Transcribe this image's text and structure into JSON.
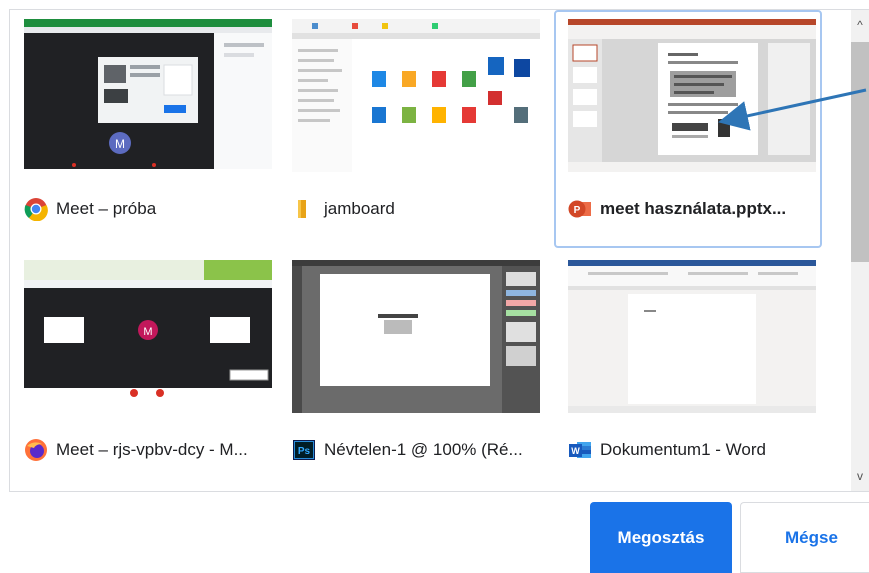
{
  "picker": {
    "tiles": [
      {
        "label": "Meet – próba",
        "icon": "chrome-icon",
        "selected": false
      },
      {
        "label": "jamboard",
        "icon": "folder-icon",
        "selected": false
      },
      {
        "label": "meet használata.pptx...",
        "icon": "powerpoint-icon",
        "icon_text": "P",
        "selected": true
      },
      {
        "label": "Meet – rjs-vpbv-dcy - M...",
        "icon": "firefox-icon",
        "selected": false
      },
      {
        "label": "Névtelen-1 @ 100% (Ré...",
        "icon": "photoshop-icon",
        "icon_text": "Ps",
        "selected": false
      },
      {
        "label": "Dokumentum1 - Word",
        "icon": "word-icon",
        "icon_text": "W",
        "selected": false
      }
    ],
    "thumbs": {
      "meet_avatar": "M",
      "meet2_avatar": "M"
    }
  },
  "scrollbar": {
    "up": "^",
    "down": "v"
  },
  "actions": {
    "share_label": "Megosztás",
    "cancel_label": "Mégse"
  },
  "colors": {
    "accent": "#1a73e8",
    "selected_border": "#a7c7f1",
    "arrow": "#2e75b6"
  }
}
